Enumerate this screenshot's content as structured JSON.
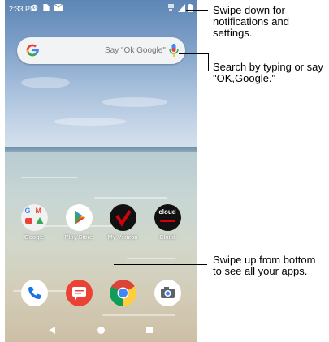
{
  "status_bar": {
    "time": "2:33 PM"
  },
  "search_bar": {
    "google_letter": "G",
    "placeholder": "Say \"Ok Google\""
  },
  "home_apps": [
    {
      "label": "Google",
      "icon": "google-folder-icon"
    },
    {
      "label": "Play Store",
      "icon": "play-store-icon"
    },
    {
      "label": "My Verizon",
      "icon": "verizon-icon"
    },
    {
      "label": "Cloud",
      "icon": "cloud-icon",
      "icon_text": "cloud"
    }
  ],
  "dock_apps": [
    {
      "icon": "phone-icon"
    },
    {
      "icon": "messages-icon"
    },
    {
      "icon": "chrome-icon"
    },
    {
      "icon": "camera-icon"
    }
  ],
  "nav_bar": [
    "back-icon",
    "home-icon",
    "recents-icon"
  ],
  "callouts": {
    "status": "Swipe down for notifications and settings.",
    "search": "Search by typing or say \"OK,Google.\"",
    "apps": "Swipe up from bottom to see all your apps."
  },
  "colors": {
    "google_blue": "#4285f4",
    "google_red": "#ea4335",
    "google_yellow": "#fbbc05",
    "google_green": "#34a853",
    "verizon_red": "#cd040b"
  }
}
